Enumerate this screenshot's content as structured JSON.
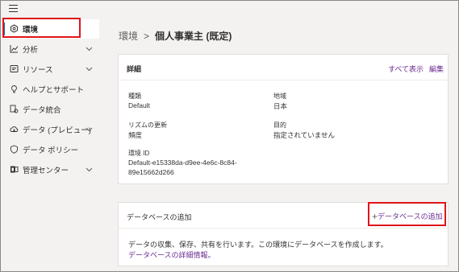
{
  "topbar": {
    "menu_icon": "hamburger-icon"
  },
  "sidebar": {
    "items": [
      {
        "label": "環境",
        "icon": "environment-icon",
        "selected": true
      },
      {
        "label": "分析",
        "icon": "analytics-icon",
        "chevron": true
      },
      {
        "label": "リソース",
        "icon": "resources-icon",
        "chevron": true
      },
      {
        "label": "ヘルプとサポート",
        "icon": "help-icon"
      },
      {
        "label": "データ統合",
        "icon": "data-integration-icon"
      },
      {
        "label": "データ (プレビュー)",
        "icon": "data-preview-icon",
        "chevron": true
      },
      {
        "label": "データ ポリシー",
        "icon": "shield-icon"
      },
      {
        "label": "管理センター",
        "icon": "admin-center-icon",
        "chevron": true
      }
    ]
  },
  "breadcrumb": {
    "parent": "環境",
    "separator": ">",
    "current": "個人事業主 (既定)"
  },
  "details_card": {
    "title": "詳細",
    "see_all": "すべて表示",
    "edit": "編集",
    "fields": {
      "type_label": "種類",
      "type_value": "Default",
      "region_label": "地域",
      "region_value": "日本",
      "refresh_label": "リズムの更新",
      "refresh_value": "頻度",
      "purpose_label": "目的",
      "purpose_value": "指定されていません",
      "env_id_label": "環境 ID",
      "env_id_line1": "Default-e15338da-d9ee-4e6c-8c84-",
      "env_id_line2": "89e15662d266"
    }
  },
  "database_card": {
    "title": "データベースの追加",
    "add_button": "データベースの追加",
    "description": "データの収集、保存、共有を行います。この環境にデータベースを作成します。",
    "details_link": "データベースの詳細情報。"
  },
  "colors": {
    "accent": "#0f6cbd",
    "link": "#6b2c91",
    "highlight": "#e0151a",
    "panel_bg": "#f3f2f1"
  }
}
